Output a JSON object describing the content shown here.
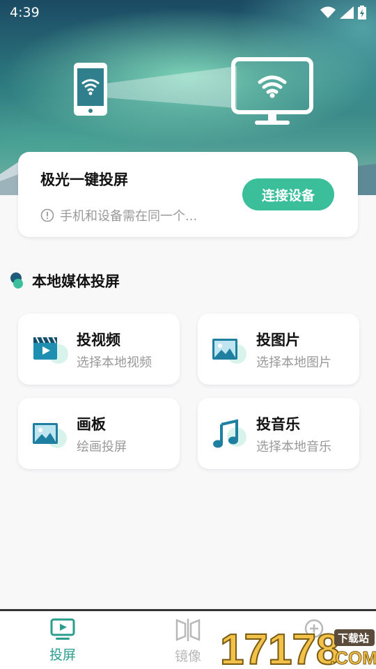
{
  "status_bar": {
    "time": "4:39"
  },
  "hero": {},
  "connect_card": {
    "title": "极光一键投屏",
    "hint": "手机和设备需在同一个...",
    "button_label": "连接设备",
    "accent_color": "#3bbf9b"
  },
  "section": {
    "title": "本地媒体投屏"
  },
  "tiles": [
    {
      "name": "投视频",
      "subtitle": "选择本地视频",
      "icon": "video-icon"
    },
    {
      "name": "投图片",
      "subtitle": "选择本地图片",
      "icon": "image-icon"
    },
    {
      "name": "画板",
      "subtitle": "绘画投屏",
      "icon": "drawing-board-icon"
    },
    {
      "name": "投音乐",
      "subtitle": "选择本地音乐",
      "icon": "music-icon"
    }
  ],
  "bottom_nav": {
    "items": [
      {
        "label": "投屏",
        "icon": "tv-icon",
        "active": true,
        "color": "#2a9d8f"
      },
      {
        "label": "镜像",
        "icon": "mirror-icon",
        "active": false,
        "color": "#b8b8b8"
      }
    ]
  },
  "watermark": {
    "text": "17178",
    "badge": "下载站",
    "suffix": ".COM"
  }
}
